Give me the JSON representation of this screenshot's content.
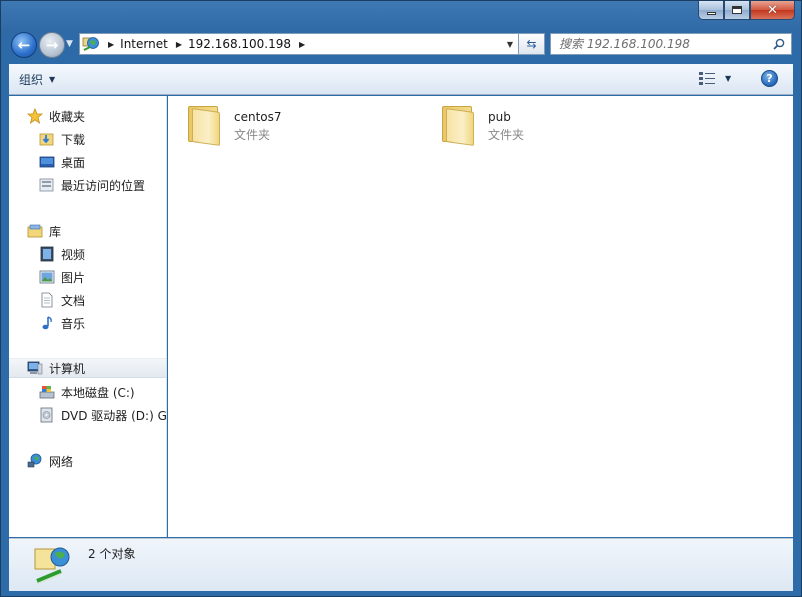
{
  "window": {
    "caption_buttons": {
      "minimize": "minimize-icon",
      "maximize": "maximize-icon",
      "close": "close-icon"
    }
  },
  "nav": {
    "address_segments": [
      "Internet",
      "192.168.100.198"
    ],
    "search_placeholder": "搜索 192.168.100.198"
  },
  "toolbar": {
    "organize_label": "组织"
  },
  "sidebar": {
    "groups": [
      {
        "label": "收藏夹",
        "icon": "star-icon",
        "items": [
          {
            "label": "下载",
            "icon": "download-folder-icon"
          },
          {
            "label": "桌面",
            "icon": "desktop-icon"
          },
          {
            "label": "最近访问的位置",
            "icon": "recent-places-icon"
          }
        ]
      },
      {
        "label": "库",
        "icon": "library-icon",
        "items": [
          {
            "label": "视频",
            "icon": "video-icon"
          },
          {
            "label": "图片",
            "icon": "pictures-icon"
          },
          {
            "label": "文档",
            "icon": "documents-icon"
          },
          {
            "label": "音乐",
            "icon": "music-icon"
          }
        ]
      },
      {
        "label": "计算机",
        "icon": "computer-icon",
        "items": [
          {
            "label": "本地磁盘 (C:)",
            "icon": "local-disk-icon"
          },
          {
            "label": "DVD 驱动器 (D:) GR",
            "icon": "dvd-drive-icon"
          }
        ]
      },
      {
        "label": "网络",
        "icon": "network-icon",
        "items": []
      }
    ]
  },
  "content": {
    "items": [
      {
        "name": "centos7",
        "type": "文件夹",
        "icon": "folder-icon"
      },
      {
        "name": "pub",
        "type": "文件夹",
        "icon": "folder-icon"
      }
    ]
  },
  "status": {
    "text": "2 个对象"
  },
  "colors": {
    "frame": "#2d6ca9",
    "toolbar": "#dbe6f3",
    "selected": "#e3e9f0"
  }
}
